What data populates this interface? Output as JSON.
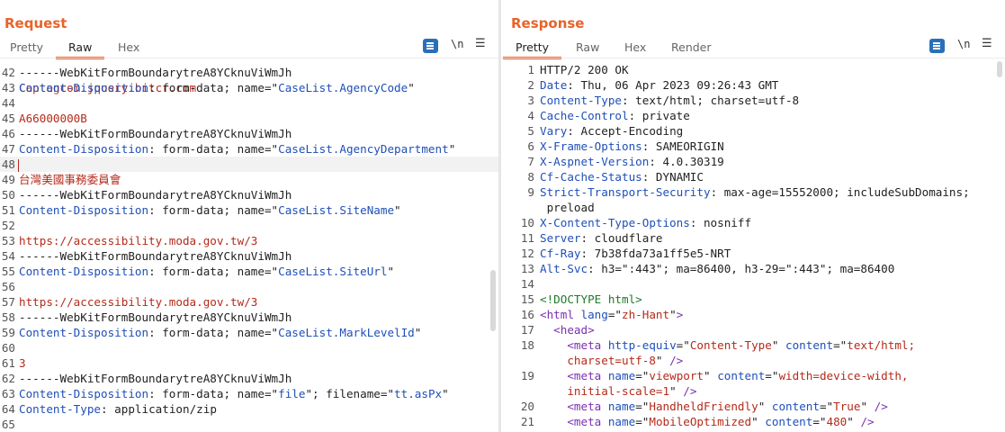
{
  "request": {
    "title": "Request",
    "tabs": [
      "Pretty",
      "Raw",
      "Hex"
    ],
    "active_tab": "Raw",
    "toolbar": {
      "newline_label": "\\n",
      "menu_glyph": "☰"
    },
    "partial_top_line": "Captagcom.jquery.bitcr.com",
    "lines": [
      {
        "n": "42",
        "parts": [
          {
            "t": "------WebKitFormBoundarytreA8YCknuViWmJh",
            "c": ""
          }
        ]
      },
      {
        "n": "43",
        "parts": [
          {
            "t": "Content-Disposition",
            "c": "key"
          },
          {
            "t": ": form-data; name=\"",
            "c": ""
          },
          {
            "t": "CaseList.AgencyCode",
            "c": "blue"
          },
          {
            "t": "\"",
            "c": ""
          }
        ]
      },
      {
        "n": "44",
        "parts": []
      },
      {
        "n": "45",
        "parts": [
          {
            "t": "A66000000B",
            "c": "red"
          }
        ]
      },
      {
        "n": "46",
        "parts": [
          {
            "t": "------WebKitFormBoundarytreA8YCknuViWmJh",
            "c": ""
          }
        ]
      },
      {
        "n": "47",
        "parts": [
          {
            "t": "Content-Disposition",
            "c": "key"
          },
          {
            "t": ": form-data; name=\"",
            "c": ""
          },
          {
            "t": "CaseList.AgencyDepartment",
            "c": "blue"
          },
          {
            "t": "\"",
            "c": ""
          }
        ]
      },
      {
        "n": "48",
        "parts": [],
        "highlight": true,
        "caret": true
      },
      {
        "n": "49",
        "parts": [
          {
            "t": "台灣美國事務委員會",
            "c": "red"
          }
        ]
      },
      {
        "n": "50",
        "parts": [
          {
            "t": "------WebKitFormBoundarytreA8YCknuViWmJh",
            "c": ""
          }
        ]
      },
      {
        "n": "51",
        "parts": [
          {
            "t": "Content-Disposition",
            "c": "key"
          },
          {
            "t": ": form-data; name=\"",
            "c": ""
          },
          {
            "t": "CaseList.SiteName",
            "c": "blue"
          },
          {
            "t": "\"",
            "c": ""
          }
        ]
      },
      {
        "n": "52",
        "parts": []
      },
      {
        "n": "53",
        "parts": [
          {
            "t": "https://accessibility.moda.gov.tw/3",
            "c": "red"
          }
        ]
      },
      {
        "n": "54",
        "parts": [
          {
            "t": "------WebKitFormBoundarytreA8YCknuViWmJh",
            "c": ""
          }
        ]
      },
      {
        "n": "55",
        "parts": [
          {
            "t": "Content-Disposition",
            "c": "key"
          },
          {
            "t": ": form-data; name=\"",
            "c": ""
          },
          {
            "t": "CaseList.SiteUrl",
            "c": "blue"
          },
          {
            "t": "\"",
            "c": ""
          }
        ]
      },
      {
        "n": "56",
        "parts": []
      },
      {
        "n": "57",
        "parts": [
          {
            "t": "https://accessibility.moda.gov.tw/3",
            "c": "red"
          }
        ]
      },
      {
        "n": "58",
        "parts": [
          {
            "t": "------WebKitFormBoundarytreA8YCknuViWmJh",
            "c": ""
          }
        ]
      },
      {
        "n": "59",
        "parts": [
          {
            "t": "Content-Disposition",
            "c": "key"
          },
          {
            "t": ": form-data; name=\"",
            "c": ""
          },
          {
            "t": "CaseList.MarkLevelId",
            "c": "blue"
          },
          {
            "t": "\"",
            "c": ""
          }
        ]
      },
      {
        "n": "60",
        "parts": []
      },
      {
        "n": "61",
        "parts": [
          {
            "t": "3",
            "c": "red"
          }
        ]
      },
      {
        "n": "62",
        "parts": [
          {
            "t": "------WebKitFormBoundarytreA8YCknuViWmJh",
            "c": ""
          }
        ]
      },
      {
        "n": "63",
        "parts": [
          {
            "t": "Content-Disposition",
            "c": "key"
          },
          {
            "t": ": form-data; name=\"",
            "c": ""
          },
          {
            "t": "file",
            "c": "blue"
          },
          {
            "t": "\"; filename=\"",
            "c": ""
          },
          {
            "t": "tt.asPx",
            "c": "blue"
          },
          {
            "t": "\"",
            "c": ""
          }
        ]
      },
      {
        "n": "64",
        "parts": [
          {
            "t": "Content-Type",
            "c": "key"
          },
          {
            "t": ": application/zip",
            "c": ""
          }
        ]
      },
      {
        "n": "65",
        "parts": []
      }
    ]
  },
  "response": {
    "title": "Response",
    "tabs": [
      "Pretty",
      "Raw",
      "Hex",
      "Render"
    ],
    "active_tab": "Pretty",
    "toolbar": {
      "newline_label": "\\n",
      "menu_glyph": "☰"
    },
    "lines": [
      {
        "n": "1",
        "parts": [
          {
            "t": "HTTP/2 200 OK",
            "c": ""
          }
        ]
      },
      {
        "n": "2",
        "parts": [
          {
            "t": "Date",
            "c": "key"
          },
          {
            "t": ": Thu, 06 Apr 2023 09:26:43 GMT",
            "c": ""
          }
        ]
      },
      {
        "n": "3",
        "parts": [
          {
            "t": "Content-Type",
            "c": "key"
          },
          {
            "t": ": text/html; charset=utf-8",
            "c": ""
          }
        ]
      },
      {
        "n": "4",
        "parts": [
          {
            "t": "Cache-Control",
            "c": "key"
          },
          {
            "t": ": private",
            "c": ""
          }
        ]
      },
      {
        "n": "5",
        "parts": [
          {
            "t": "Vary",
            "c": "key"
          },
          {
            "t": ": Accept-Encoding",
            "c": ""
          }
        ]
      },
      {
        "n": "6",
        "parts": [
          {
            "t": "X-Frame-Options",
            "c": "key"
          },
          {
            "t": ": SAMEORIGIN",
            "c": ""
          }
        ]
      },
      {
        "n": "7",
        "parts": [
          {
            "t": "X-Aspnet-Version",
            "c": "key"
          },
          {
            "t": ": 4.0.30319",
            "c": ""
          }
        ]
      },
      {
        "n": "8",
        "parts": [
          {
            "t": "Cf-Cache-Status",
            "c": "key"
          },
          {
            "t": ": DYNAMIC",
            "c": ""
          }
        ]
      },
      {
        "n": "9",
        "parts": [
          {
            "t": "Strict-Transport-Security",
            "c": "key"
          },
          {
            "t": ": max-age=15552000; includeSubDomains;",
            "c": ""
          }
        ]
      },
      {
        "n": "",
        "parts": [
          {
            "t": " preload",
            "c": ""
          }
        ]
      },
      {
        "n": "10",
        "parts": [
          {
            "t": "X-Content-Type-Options",
            "c": "key"
          },
          {
            "t": ": nosniff",
            "c": ""
          }
        ]
      },
      {
        "n": "11",
        "parts": [
          {
            "t": "Server",
            "c": "key"
          },
          {
            "t": ": cloudflare",
            "c": ""
          }
        ]
      },
      {
        "n": "12",
        "parts": [
          {
            "t": "Cf-Ray",
            "c": "key"
          },
          {
            "t": ": 7b38fda73a1ff5e5-NRT",
            "c": ""
          }
        ]
      },
      {
        "n": "13",
        "parts": [
          {
            "t": "Alt-Svc",
            "c": "key"
          },
          {
            "t": ": h3=\":443\"; ma=86400, h3-29=\":443\"; ma=86400",
            "c": ""
          }
        ]
      },
      {
        "n": "14",
        "parts": []
      },
      {
        "n": "15",
        "parts": [
          {
            "t": "<!DOCTYPE html>",
            "c": "green"
          }
        ]
      },
      {
        "n": "16",
        "parts": [
          {
            "t": "<html ",
            "c": "purple"
          },
          {
            "t": "lang",
            "c": "key"
          },
          {
            "t": "=\"",
            "c": ""
          },
          {
            "t": "zh-Hant",
            "c": "red"
          },
          {
            "t": "\"",
            "c": ""
          },
          {
            "t": ">",
            "c": "purple"
          }
        ]
      },
      {
        "n": "17",
        "parts": [
          {
            "t": "  ",
            "c": ""
          },
          {
            "t": "<head>",
            "c": "purple"
          }
        ]
      },
      {
        "n": "18",
        "parts": [
          {
            "t": "    ",
            "c": ""
          },
          {
            "t": "<meta ",
            "c": "purple"
          },
          {
            "t": "http-equiv",
            "c": "key"
          },
          {
            "t": "=\"",
            "c": ""
          },
          {
            "t": "Content-Type",
            "c": "red"
          },
          {
            "t": "\" ",
            "c": ""
          },
          {
            "t": "content",
            "c": "key"
          },
          {
            "t": "=\"",
            "c": ""
          },
          {
            "t": "text/html;",
            "c": "red"
          }
        ]
      },
      {
        "n": "",
        "parts": [
          {
            "t": "    ",
            "c": ""
          },
          {
            "t": "charset=utf-8",
            "c": "red"
          },
          {
            "t": "\" ",
            "c": ""
          },
          {
            "t": "/>",
            "c": "purple"
          }
        ]
      },
      {
        "n": "19",
        "parts": [
          {
            "t": "    ",
            "c": ""
          },
          {
            "t": "<meta ",
            "c": "purple"
          },
          {
            "t": "name",
            "c": "key"
          },
          {
            "t": "=\"",
            "c": ""
          },
          {
            "t": "viewport",
            "c": "red"
          },
          {
            "t": "\" ",
            "c": ""
          },
          {
            "t": "content",
            "c": "key"
          },
          {
            "t": "=\"",
            "c": ""
          },
          {
            "t": "width=device-width,",
            "c": "red"
          }
        ]
      },
      {
        "n": "",
        "parts": [
          {
            "t": "    ",
            "c": ""
          },
          {
            "t": "initial-scale=1",
            "c": "red"
          },
          {
            "t": "\" ",
            "c": ""
          },
          {
            "t": "/>",
            "c": "purple"
          }
        ]
      },
      {
        "n": "20",
        "parts": [
          {
            "t": "    ",
            "c": ""
          },
          {
            "t": "<meta ",
            "c": "purple"
          },
          {
            "t": "name",
            "c": "key"
          },
          {
            "t": "=\"",
            "c": ""
          },
          {
            "t": "HandheldFriendly",
            "c": "red"
          },
          {
            "t": "\" ",
            "c": ""
          },
          {
            "t": "content",
            "c": "key"
          },
          {
            "t": "=\"",
            "c": ""
          },
          {
            "t": "True",
            "c": "red"
          },
          {
            "t": "\" ",
            "c": ""
          },
          {
            "t": "/>",
            "c": "purple"
          }
        ]
      },
      {
        "n": "21",
        "parts": [
          {
            "t": "    ",
            "c": ""
          },
          {
            "t": "<meta ",
            "c": "purple"
          },
          {
            "t": "name",
            "c": "key"
          },
          {
            "t": "=\"",
            "c": ""
          },
          {
            "t": "MobileOptimized",
            "c": "red"
          },
          {
            "t": "\" ",
            "c": ""
          },
          {
            "t": "content",
            "c": "key"
          },
          {
            "t": "=\"",
            "c": ""
          },
          {
            "t": "480",
            "c": "red"
          },
          {
            "t": "\" ",
            "c": ""
          },
          {
            "t": "/>",
            "c": "purple"
          }
        ]
      }
    ]
  },
  "layout_controls": {
    "buttons": [
      {
        "name": "split-view-icon",
        "active": true
      },
      {
        "name": "stacked-view-icon",
        "active": false
      },
      {
        "name": "single-view-icon",
        "active": false
      }
    ]
  }
}
